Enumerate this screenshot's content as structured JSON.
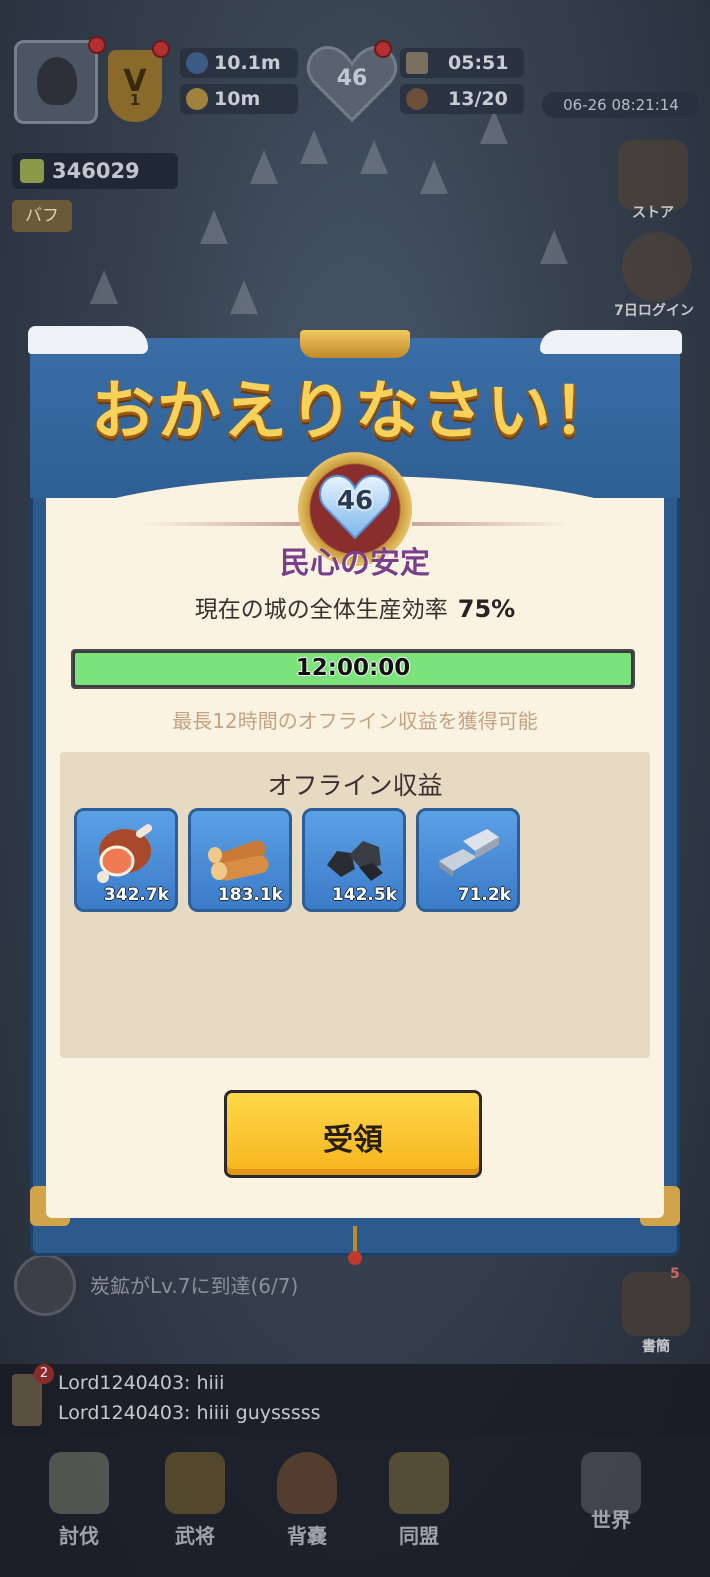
{
  "hud": {
    "stat_top": "10.1m",
    "stat_bottom": "10m",
    "timer": "05:51",
    "troops": "13/20",
    "heart_level": "46",
    "date": "06-26 08:21:14",
    "power": "346029",
    "buff_label": "バフ",
    "vip_level": "1",
    "store_label": "ストア",
    "login_label": "7日ログイン"
  },
  "dialog": {
    "title": "おかえりなさい！",
    "heart_level": "46",
    "stability_label": "民心の安定",
    "efficiency_label": "現在の城の全体生産効率",
    "efficiency_value": "75%",
    "efficiency_fraction": 0.75,
    "timer_text": "12:00:00",
    "timer_fill_fraction": 1.0,
    "offline_note": "最長12時間のオフライン収益を獲得可能",
    "earnings_title": "オフライン収益",
    "items": [
      {
        "icon": "meat-icon",
        "value": "342.7k"
      },
      {
        "icon": "wood-icon",
        "value": "183.1k"
      },
      {
        "icon": "coal-icon",
        "value": "142.5k"
      },
      {
        "icon": "iron-icon",
        "value": "71.2k"
      }
    ],
    "claim_label": "受領"
  },
  "quest": {
    "text": "炭鉱がLv.7に到達(6/7)",
    "mail_label": "書簡",
    "mail_badge": "5"
  },
  "chat": {
    "badge": "2",
    "lines": [
      "Lord1240403: hiii",
      "Lord1240403: hiiii guysssss"
    ]
  },
  "nav": [
    "討伐",
    "武将",
    "背嚢",
    "同盟",
    "世界"
  ],
  "colors": {
    "accent_gold": "#f7d25a",
    "dialog_blue": "#2c5a8c",
    "panel_cream": "#fbf3e1",
    "timer_green": "#7ce37c",
    "button_yellow": "#ffd84a",
    "stability_purple": "#7a3f88"
  }
}
